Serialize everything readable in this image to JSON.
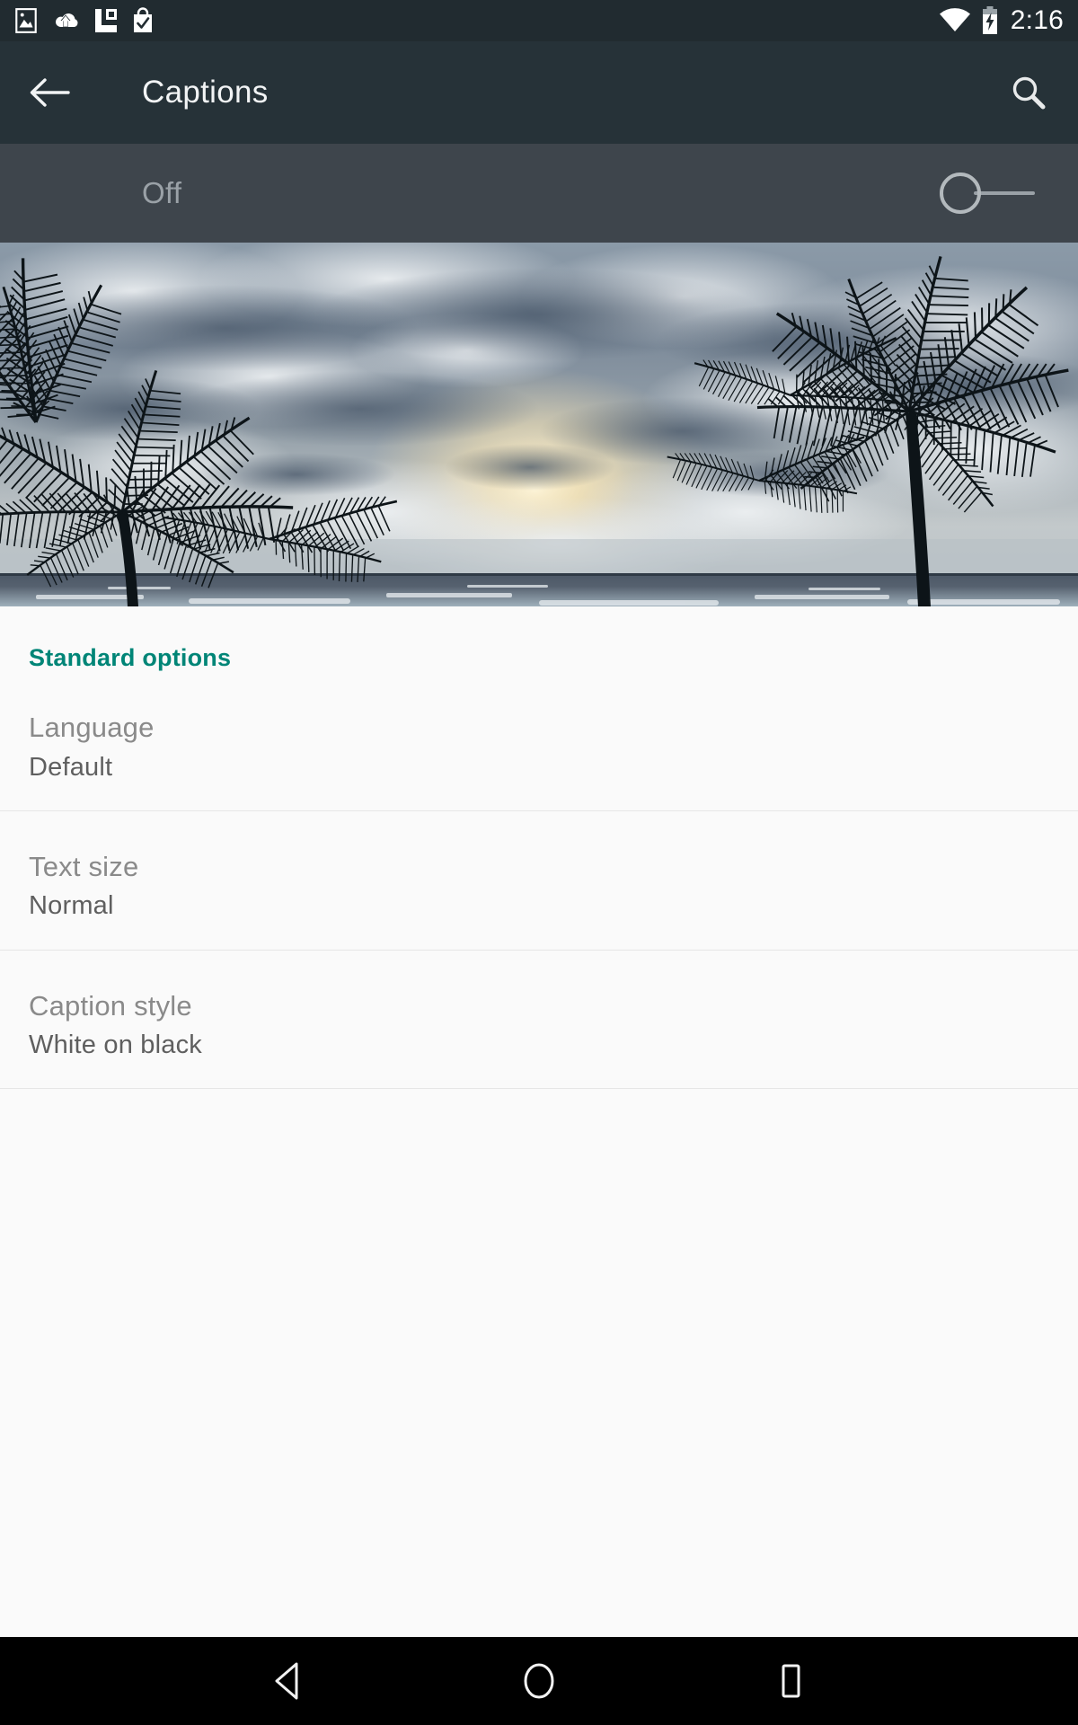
{
  "status_bar": {
    "time": "2:16",
    "left_icons": [
      {
        "name": "photo-icon",
        "label": "Photo"
      },
      {
        "name": "cloud-upload-icon",
        "label": "Cloud upload"
      },
      {
        "name": "app-badge-icon",
        "label": "App"
      },
      {
        "name": "shopping-bag-check-icon",
        "label": "Shopping bag complete"
      }
    ],
    "right_icons": [
      {
        "name": "wifi-icon",
        "label": "Wi-Fi"
      },
      {
        "name": "battery-charging-icon",
        "label": "Battery charging"
      }
    ],
    "background_color": "#212b30"
  },
  "app_bar": {
    "title": "Captions",
    "back_label": "Navigate up",
    "search_label": "Search",
    "background_color": "#263238"
  },
  "master_switch": {
    "label": "Off",
    "state": "off",
    "background_color": "#3e454c"
  },
  "preview": {
    "name": "caption-preview-image",
    "description": "Tropical sunset with palm tree silhouettes over the ocean"
  },
  "main": {
    "section_header": "Standard options",
    "accent_color": "#008577",
    "items": [
      {
        "title": "Language",
        "value": "Default"
      },
      {
        "title": "Text size",
        "value": "Normal"
      },
      {
        "title": "Caption style",
        "value": "White on black"
      }
    ]
  },
  "nav_bar": {
    "buttons": [
      {
        "name": "nav-back-button",
        "label": "Back"
      },
      {
        "name": "nav-home-button",
        "label": "Home"
      },
      {
        "name": "nav-recents-button",
        "label": "Recents"
      }
    ],
    "background_color": "#000000"
  }
}
